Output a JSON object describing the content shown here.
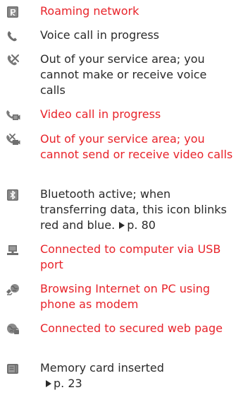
{
  "colors": {
    "text": "#2a2a2a",
    "highlight": "#e8232a",
    "icon_gray": "#6f6f6f"
  },
  "items": [
    {
      "icon": "roaming-r-icon",
      "text": "Roaming network",
      "highlight": true
    },
    {
      "icon": "phone-handset-icon",
      "text": "Voice call in progress",
      "highlight": false
    },
    {
      "icon": "no-voice-service-icon",
      "text": "Out of your service area; you cannot make or receive voice calls",
      "highlight": false
    },
    {
      "icon": "video-call-icon",
      "text": "Video call in progress",
      "highlight": true
    },
    {
      "icon": "no-video-service-icon",
      "text": "Out of your service area; you cannot send or receive video calls",
      "highlight": true
    },
    {
      "icon": "bluetooth-icon",
      "text": "Bluetooth active; when transferring data, this icon blinks red and blue.",
      "ref": "p. 80",
      "highlight": false
    },
    {
      "icon": "usb-computer-icon",
      "text": "Connected to computer via USB port",
      "highlight": true
    },
    {
      "icon": "pc-modem-icon",
      "text": "Browsing Internet on PC using phone as modem",
      "highlight": true
    },
    {
      "icon": "secured-web-lock-icon",
      "text": "Connected to secured web page",
      "highlight": true
    },
    {
      "icon": "memory-card-icon",
      "text": "Memory card inserted",
      "ref": "p. 23",
      "highlight": false
    }
  ]
}
